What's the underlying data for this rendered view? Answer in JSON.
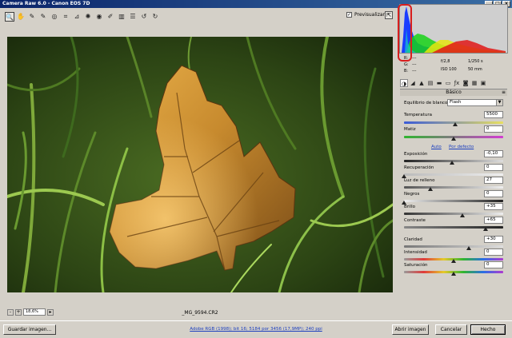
{
  "window": {
    "title": "Camera Raw 6.0  -  Canon EOS 7D",
    "buttons": [
      "_",
      "□",
      "×"
    ]
  },
  "toolbar": {
    "tools": [
      {
        "name": "zoom-tool",
        "glyph": "🔍"
      },
      {
        "name": "hand-tool",
        "glyph": "✋"
      },
      {
        "name": "white-balance-tool",
        "glyph": "✎"
      },
      {
        "name": "color-sampler-tool",
        "glyph": "✎"
      },
      {
        "name": "targeted-adjustment-tool",
        "glyph": "◎"
      },
      {
        "name": "crop-tool",
        "glyph": "⌗"
      },
      {
        "name": "straighten-tool",
        "glyph": "⊿"
      },
      {
        "name": "spot-removal-tool",
        "glyph": "✺"
      },
      {
        "name": "red-eye-tool",
        "glyph": "◉"
      },
      {
        "name": "adjustment-brush-tool",
        "glyph": "✐"
      },
      {
        "name": "graduated-filter-tool",
        "glyph": "▥"
      },
      {
        "name": "preferences-tool",
        "glyph": "☰"
      },
      {
        "name": "rotate-ccw-tool",
        "glyph": "↺"
      },
      {
        "name": "rotate-cw-tool",
        "glyph": "↻"
      }
    ],
    "preview_label": "Previsualizar",
    "preview_checked": "✓"
  },
  "status": {
    "zoom": "18,6%",
    "filename": "_MG_9594.CR2",
    "zoom_minus": "-",
    "zoom_plus": "+"
  },
  "camera_info": {
    "r": "R:",
    "g": "G:",
    "b": "B:",
    "dash": "---",
    "aperture": "f/2,8",
    "shutter": "1/250 s",
    "iso": "ISO 100",
    "focal": "50 mm"
  },
  "panel": {
    "title": "Básico",
    "white_balance_label": "Equilibrio de blancos:",
    "white_balance_value": "Flash",
    "temperatura": {
      "label": "Temperatura",
      "value": "5500",
      "level": 0.52
    },
    "matiz": {
      "label": "Matiz",
      "value": "0",
      "level": 0.5
    },
    "auto_link": "Auto",
    "default_link": "Por defecto",
    "exposicion": {
      "label": "Exposición",
      "value": "-0,10",
      "level": 0.48
    },
    "recuperacion": {
      "label": "Recuperación",
      "value": "0",
      "level": 0.0
    },
    "luz_relleno": {
      "label": "Luz de relleno",
      "value": "27",
      "level": 0.27
    },
    "negros": {
      "label": "Negros",
      "value": "0",
      "level": 0.0
    },
    "brillo": {
      "label": "Brillo",
      "value": "+35",
      "level": 0.59
    },
    "contraste": {
      "label": "Contraste",
      "value": "+65",
      "level": 0.82
    },
    "claridad": {
      "label": "Claridad",
      "value": "+30",
      "level": 0.65
    },
    "intensidad": {
      "label": "Intensidad",
      "value": "0",
      "level": 0.5
    },
    "saturacion": {
      "label": "Saturación",
      "value": "0",
      "level": 0.5
    }
  },
  "bottom": {
    "save_label": "Guardar imagen...",
    "workflow_link": "Adobe RGB (1998); bit 16; 5184 por 3456 (17,9MP); 240 ppi",
    "open_label": "Abrir imagen",
    "cancel_label": "Cancelar",
    "done_label": "Hecho"
  },
  "colors": {
    "accent_link": "#1c3fbf",
    "annotation": "#d81e1e",
    "title_bar": "#0a246a"
  }
}
